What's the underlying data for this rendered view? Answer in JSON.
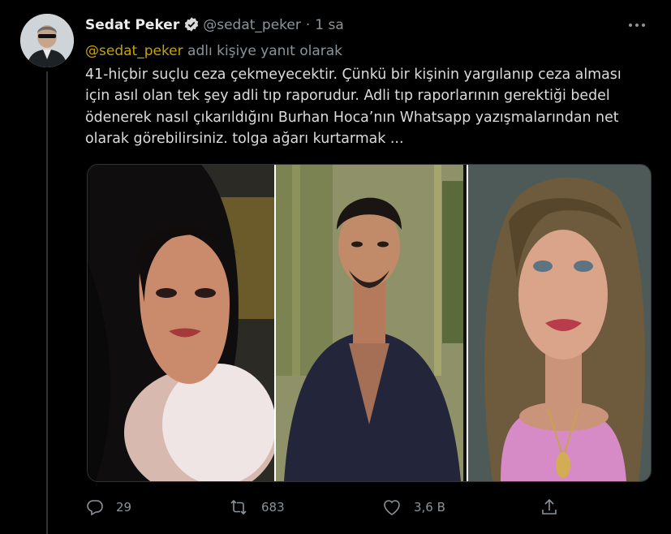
{
  "tweet": {
    "author_name": "Sedat Peker",
    "author_handle": "@sedat_peker",
    "separator": "·",
    "time": "1 sa",
    "reply_mention": "@sedat_peker",
    "reply_suffix": "adlı kişiye yanıt olarak",
    "text_lines": [
      "41-hiçbir suçlu ceza çekmeyecektir. Çünkü bir kişinin yargılanıp ceza alması",
      "için asıl olan tek şey adli tıp raporudur. Adli tıp raporlarının gerektiği bedel",
      "ödenerek nasıl çıkarıldığını Burhan Hoca’nın Whatsapp yazışmalarından net",
      "olarak görebilirsiniz. tolga ağarı kurtarmak ..."
    ]
  },
  "actions": {
    "reply_count": "29",
    "retweet_count": "683",
    "like_count": "3,6 B"
  },
  "icons": {
    "verified": "verified-badge-icon",
    "more": "more-icon",
    "reply": "reply-icon",
    "retweet": "retweet-icon",
    "like": "heart-icon",
    "share": "share-icon"
  },
  "colors": {
    "background": "#000000",
    "mention": "#c6a300",
    "muted": "#8b949b",
    "text": "#dcdcdc"
  }
}
